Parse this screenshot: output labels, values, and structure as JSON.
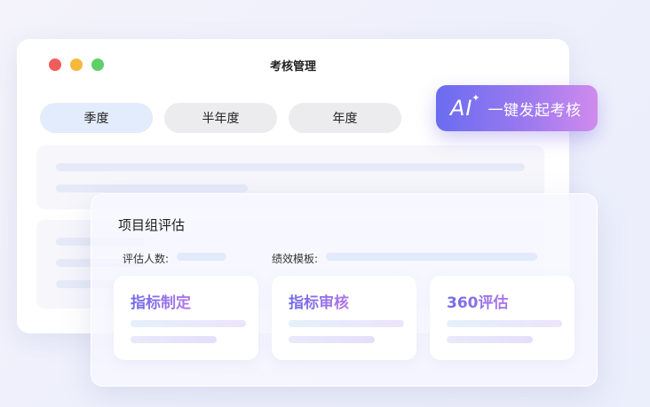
{
  "window": {
    "title": "考核管理",
    "controls": [
      "close-dot",
      "minimize-dot",
      "maximize-dot"
    ]
  },
  "tabs": [
    {
      "label": "季度",
      "active": true
    },
    {
      "label": "半年度",
      "active": false
    },
    {
      "label": "年度",
      "active": false
    }
  ],
  "ai_button": {
    "mark": "AI",
    "label": "一键发起考核",
    "icon": "sparkle-icon",
    "gradient": [
      "#6a6cf0",
      "#d08bed"
    ]
  },
  "card": {
    "title": "项目组评估",
    "fields": [
      {
        "label": "评估人数:"
      },
      {
        "label": "绩效模板:"
      }
    ],
    "items": [
      {
        "title": "指标制定"
      },
      {
        "title": "指标审核"
      },
      {
        "title": "360评估"
      }
    ]
  },
  "colors": {
    "accent": "#7b6ff0",
    "tab_active_bg": "#e3ecfc",
    "tab_bg": "#ececee"
  }
}
